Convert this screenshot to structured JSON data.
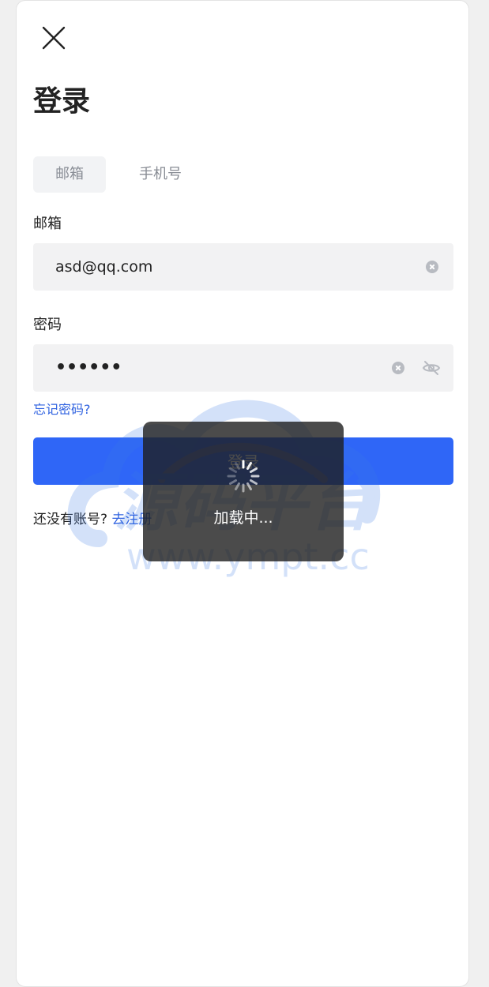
{
  "page": {
    "title": "登录"
  },
  "tabs": [
    {
      "label": "邮箱",
      "active": true
    },
    {
      "label": "手机号",
      "active": false
    }
  ],
  "email": {
    "label": "邮箱",
    "value": "asd@qq.com"
  },
  "password": {
    "label": "密码",
    "masked_value": "••••••"
  },
  "forgot_link": "忘记密码?",
  "login_button": "登录",
  "register": {
    "prompt": "还没有账号?",
    "link": "去注册"
  },
  "watermark": {
    "brand_text": "源码平台",
    "url_text": "www.ympt.cc"
  },
  "loading_toast": {
    "text": "加载中..."
  },
  "icons": {
    "close": "close-icon",
    "clear": "clear-icon",
    "eye": "eye-off-icon",
    "spinner": "spinner-icon"
  },
  "colors": {
    "primary": "#2f66f7",
    "link": "#2f62e0",
    "input_bg": "#f2f2f3",
    "toast_bg": "#1e1e1e"
  }
}
